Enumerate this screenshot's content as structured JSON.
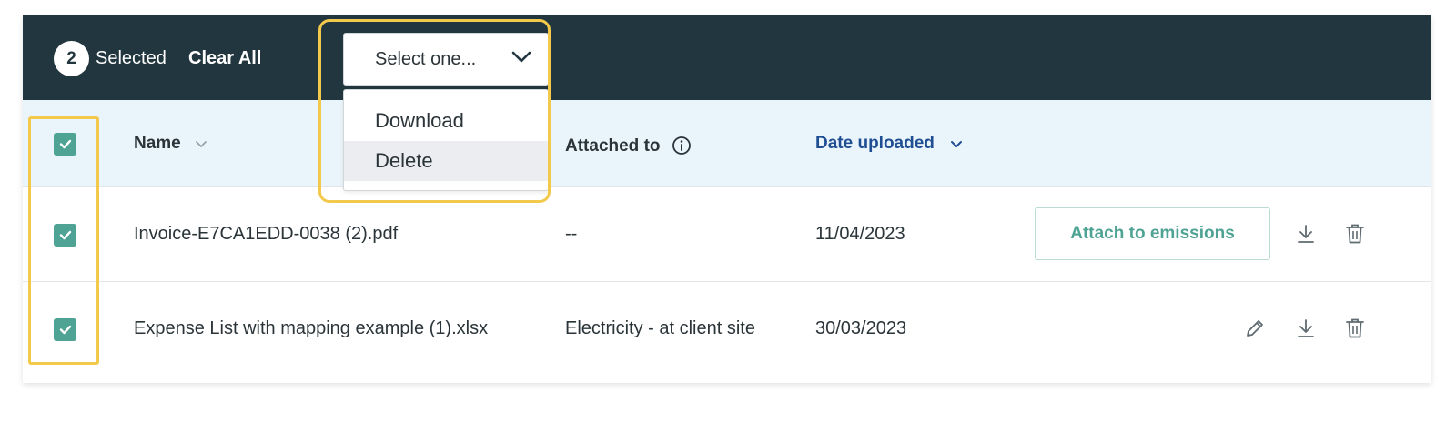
{
  "toolbar": {
    "selected_count": "2",
    "selected_label": "Selected",
    "clear_all_label": "Clear All"
  },
  "bulk_action": {
    "placeholder": "Select one...",
    "options": [
      "Download",
      "Delete"
    ],
    "highlighted_option": "Delete"
  },
  "table": {
    "columns": {
      "name": "Name",
      "attached_to": "Attached to",
      "date_uploaded": "Date uploaded"
    },
    "rows": [
      {
        "name": "Invoice-E7CA1EDD-0038 (2).pdf",
        "attached_to": "--",
        "date_uploaded": "11/04/2023",
        "action_label": "Attach to emissions",
        "checked": true
      },
      {
        "name": "Expense List with mapping example (1).xlsx",
        "attached_to": "Electricity - at client site",
        "date_uploaded": "30/03/2023",
        "checked": true
      }
    ]
  },
  "colors": {
    "topbar": "#22363f",
    "checkbox": "#4ea394",
    "header_bg": "#eaf4fb",
    "sort_active": "#1f4e93",
    "highlight": "#f3c94c"
  }
}
